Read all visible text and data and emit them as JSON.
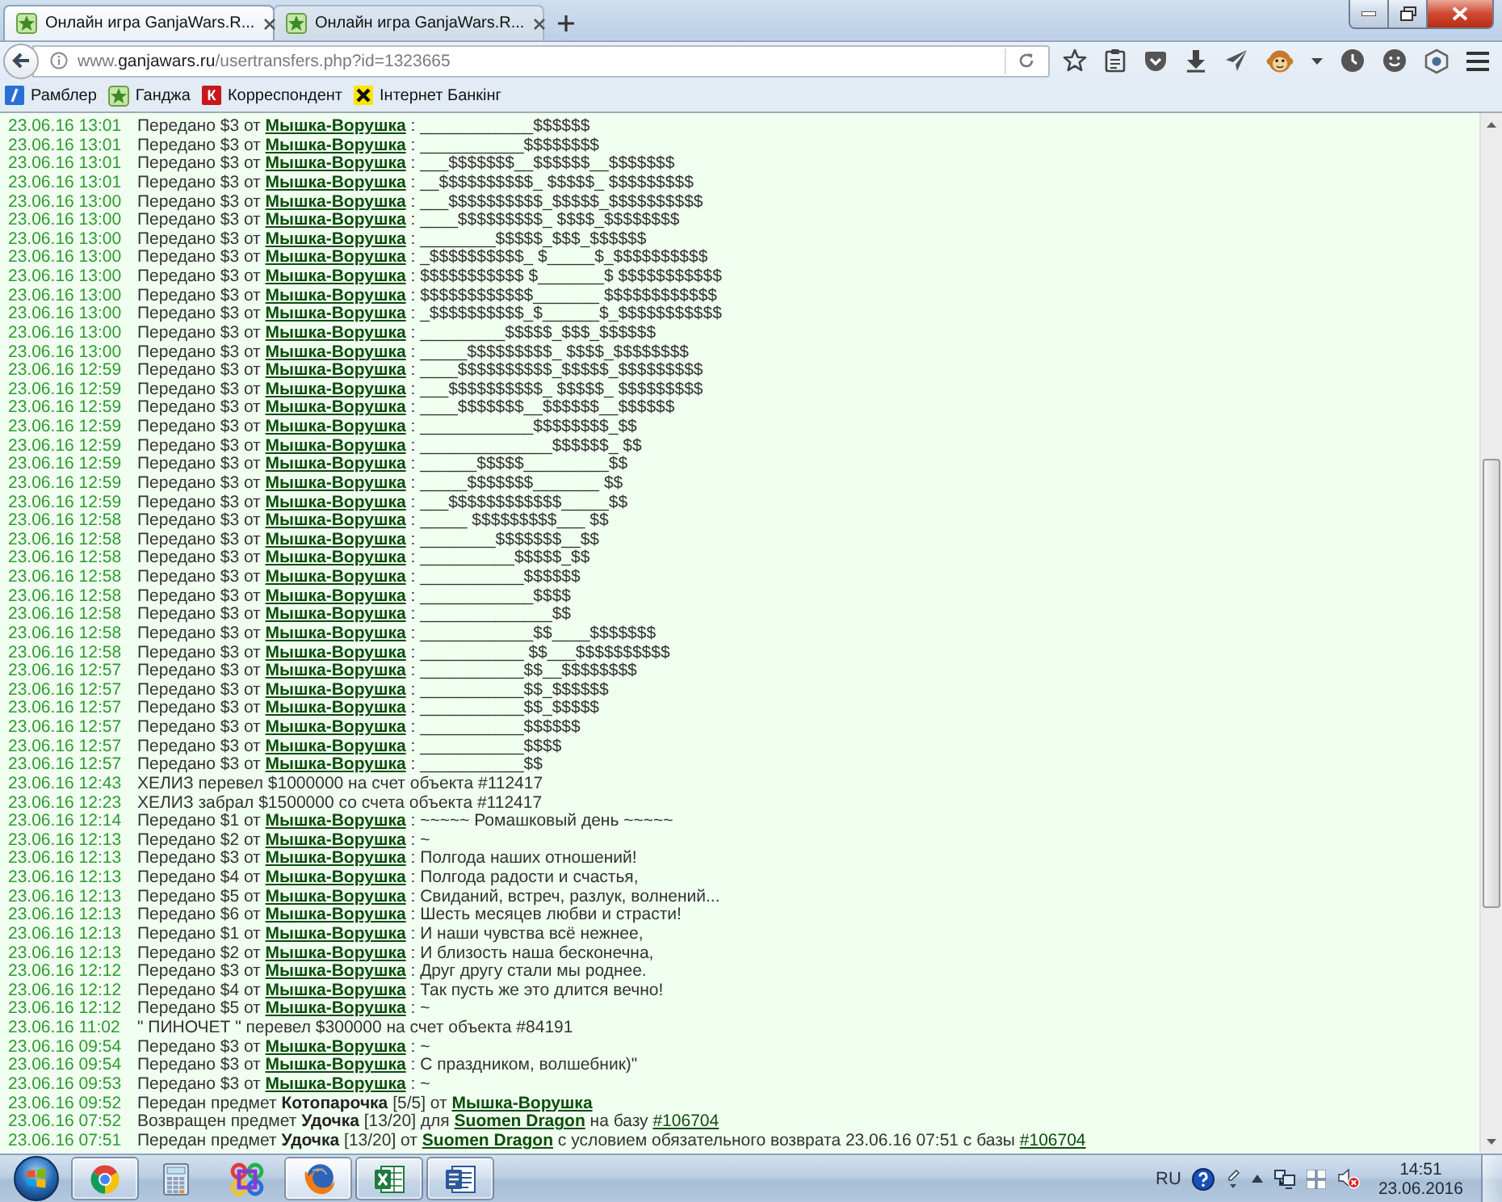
{
  "browser": {
    "tabs": [
      {
        "title": "Онлайн игра GanjaWars.R...",
        "selected": true
      },
      {
        "title": "Онлайн игра GanjaWars.R...",
        "selected": false
      }
    ],
    "address_bar": {
      "url_prefix": "www.",
      "url_domain": "ganjawars.ru",
      "url_path": "/usertransfers.php?id=1323665"
    },
    "bookmarks": [
      {
        "kind": "slash",
        "label": "Рамблер"
      },
      {
        "kind": "star",
        "label": "Ганджа"
      },
      {
        "kind": "letter",
        "icon_text": "К",
        "label": "Корреспондент"
      },
      {
        "kind": "cross",
        "label": "Інтернет Банкінг"
      }
    ]
  },
  "log": {
    "rows": [
      {
        "time": "23.06.16 13:01",
        "kind": "transfer",
        "action": "Передано $3 от",
        "user": "Мышка-Ворушка",
        "message": ": ____________$$$$$$"
      },
      {
        "time": "23.06.16 13:01",
        "kind": "transfer",
        "action": "Передано $3 от",
        "user": "Мышка-Ворушка",
        "message": ": ___________$$$$$$$$"
      },
      {
        "time": "23.06.16 13:01",
        "kind": "transfer",
        "action": "Передано $3 от",
        "user": "Мышка-Ворушка",
        "message": ": ___$$$$$$$__$$$$$$__$$$$$$$"
      },
      {
        "time": "23.06.16 13:01",
        "kind": "transfer",
        "action": "Передано $3 от",
        "user": "Мышка-Ворушка",
        "message": ": __$$$$$$$$$$_ $$$$$_ $$$$$$$$$"
      },
      {
        "time": "23.06.16 13:00",
        "kind": "transfer",
        "action": "Передано $3 от",
        "user": "Мышка-Ворушка",
        "message": ": ___$$$$$$$$$$_$$$$$_$$$$$$$$$$"
      },
      {
        "time": "23.06.16 13:00",
        "kind": "transfer",
        "action": "Передано $3 от",
        "user": "Мышка-Ворушка",
        "message": ": ____$$$$$$$$$_ $$$$_$$$$$$$$"
      },
      {
        "time": "23.06.16 13:00",
        "kind": "transfer",
        "action": "Передано $3 от",
        "user": "Мышка-Ворушка",
        "message": ": ________$$$$$_$$$_$$$$$$"
      },
      {
        "time": "23.06.16 13:00",
        "kind": "transfer",
        "action": "Передано $3 от",
        "user": "Мышка-Ворушка",
        "message": ": _$$$$$$$$$$_ $_____$_$$$$$$$$$$"
      },
      {
        "time": "23.06.16 13:00",
        "kind": "transfer",
        "action": "Передано $3 от",
        "user": "Мышка-Ворушка",
        "message": ": $$$$$$$$$$$ $_______$ $$$$$$$$$$$"
      },
      {
        "time": "23.06.16 13:00",
        "kind": "transfer",
        "action": "Передано $3 от",
        "user": "Мышка-Ворушка",
        "message": ": $$$$$$$$$$$$_______ $$$$$$$$$$$$"
      },
      {
        "time": "23.06.16 13:00",
        "kind": "transfer",
        "action": "Передано $3 от",
        "user": "Мышка-Ворушка",
        "message": ": _$$$$$$$$$$_$______$_$$$$$$$$$$$"
      },
      {
        "time": "23.06.16 13:00",
        "kind": "transfer",
        "action": "Передано $3 от",
        "user": "Мышка-Ворушка",
        "message": ": _________$$$$$_$$$_$$$$$$"
      },
      {
        "time": "23.06.16 13:00",
        "kind": "transfer",
        "action": "Передано $3 от",
        "user": "Мышка-Ворушка",
        "message": ": _____$$$$$$$$$_ $$$$_$$$$$$$$"
      },
      {
        "time": "23.06.16 12:59",
        "kind": "transfer",
        "action": "Передано $3 от",
        "user": "Мышка-Ворушка",
        "message": ": ____$$$$$$$$$$_$$$$$_$$$$$$$$$"
      },
      {
        "time": "23.06.16 12:59",
        "kind": "transfer",
        "action": "Передано $3 от",
        "user": "Мышка-Ворушка",
        "message": ": ___$$$$$$$$$$_ $$$$$_ $$$$$$$$$"
      },
      {
        "time": "23.06.16 12:59",
        "kind": "transfer",
        "action": "Передано $3 от",
        "user": "Мышка-Ворушка",
        "message": ": ____$$$$$$$__$$$$$$__$$$$$$"
      },
      {
        "time": "23.06.16 12:59",
        "kind": "transfer",
        "action": "Передано $3 от",
        "user": "Мышка-Ворушка",
        "message": ": ____________$$$$$$$$_$$"
      },
      {
        "time": "23.06.16 12:59",
        "kind": "transfer",
        "action": "Передано $3 от",
        "user": "Мышка-Ворушка",
        "message": ": ______________$$$$$$_ $$"
      },
      {
        "time": "23.06.16 12:59",
        "kind": "transfer",
        "action": "Передано $3 от",
        "user": "Мышка-Ворушка",
        "message": ": ______$$$$$_________$$"
      },
      {
        "time": "23.06.16 12:59",
        "kind": "transfer",
        "action": "Передано $3 от",
        "user": "Мышка-Ворушка",
        "message": ": _____$$$$$$$_______ $$"
      },
      {
        "time": "23.06.16 12:59",
        "kind": "transfer",
        "action": "Передано $3 от",
        "user": "Мышка-Ворушка",
        "message": ": ___$$$$$$$$$$$$_____$$"
      },
      {
        "time": "23.06.16 12:58",
        "kind": "transfer",
        "action": "Передано $3 от",
        "user": "Мышка-Ворушка",
        "message": ": _____ $$$$$$$$$___ $$"
      },
      {
        "time": "23.06.16 12:58",
        "kind": "transfer",
        "action": "Передано $3 от",
        "user": "Мышка-Ворушка",
        "message": ": ________$$$$$$$__$$"
      },
      {
        "time": "23.06.16 12:58",
        "kind": "transfer",
        "action": "Передано $3 от",
        "user": "Мышка-Ворушка",
        "message": ": __________$$$$$_$$"
      },
      {
        "time": "23.06.16 12:58",
        "kind": "transfer",
        "action": "Передано $3 от",
        "user": "Мышка-Ворушка",
        "message": ": ___________$$$$$$"
      },
      {
        "time": "23.06.16 12:58",
        "kind": "transfer",
        "action": "Передано $3 от",
        "user": "Мышка-Ворушка",
        "message": ": ____________$$$$"
      },
      {
        "time": "23.06.16 12:58",
        "kind": "transfer",
        "action": "Передано $3 от",
        "user": "Мышка-Ворушка",
        "message": ": ______________$$"
      },
      {
        "time": "23.06.16 12:58",
        "kind": "transfer",
        "action": "Передано $3 от",
        "user": "Мышка-Ворушка",
        "message": ": ____________$$____$$$$$$$"
      },
      {
        "time": "23.06.16 12:58",
        "kind": "transfer",
        "action": "Передано $3 от",
        "user": "Мышка-Ворушка",
        "message": ": ___________ $$___$$$$$$$$$$"
      },
      {
        "time": "23.06.16 12:57",
        "kind": "transfer",
        "action": "Передано $3 от",
        "user": "Мышка-Ворушка",
        "message": ": ___________$$__$$$$$$$$"
      },
      {
        "time": "23.06.16 12:57",
        "kind": "transfer",
        "action": "Передано $3 от",
        "user": "Мышка-Ворушка",
        "message": ": ___________$$_$$$$$$"
      },
      {
        "time": "23.06.16 12:57",
        "kind": "transfer",
        "action": "Передано $3 от",
        "user": "Мышка-Ворушка",
        "message": ": ___________$$_$$$$$"
      },
      {
        "time": "23.06.16 12:57",
        "kind": "transfer",
        "action": "Передано $3 от",
        "user": "Мышка-Ворушка",
        "message": ": ___________$$$$$$"
      },
      {
        "time": "23.06.16 12:57",
        "kind": "transfer",
        "action": "Передано $3 от",
        "user": "Мышка-Ворушка",
        "message": ": ___________$$$$"
      },
      {
        "time": "23.06.16 12:57",
        "kind": "transfer",
        "action": "Передано $3 от",
        "user": "Мышка-Ворушка",
        "message": ": ___________$$"
      },
      {
        "time": "23.06.16 12:43",
        "kind": "event",
        "parts": [
          {
            "kind": "text",
            "text": "ХЕЛИЗ перевел $1000000 на счет объекта #112417"
          }
        ]
      },
      {
        "time": "23.06.16 12:23",
        "kind": "event",
        "parts": [
          {
            "kind": "text",
            "text": "ХЕЛИЗ забрал $1500000 со счета объекта #112417"
          }
        ]
      },
      {
        "time": "23.06.16 12:14",
        "kind": "transfer",
        "action": "Передано $1 от",
        "user": "Мышка-Ворушка",
        "message": ": ~~~~~ Ромашковый день ~~~~~"
      },
      {
        "time": "23.06.16 12:13",
        "kind": "transfer",
        "action": "Передано $2 от",
        "user": "Мышка-Ворушка",
        "message": ": ~"
      },
      {
        "time": "23.06.16 12:13",
        "kind": "transfer",
        "action": "Передано $3 от",
        "user": "Мышка-Ворушка",
        "message": ": Полгода наших отношений!"
      },
      {
        "time": "23.06.16 12:13",
        "kind": "transfer",
        "action": "Передано $4 от",
        "user": "Мышка-Ворушка",
        "message": ": Полгода радости и счастья,"
      },
      {
        "time": "23.06.16 12:13",
        "kind": "transfer",
        "action": "Передано $5 от",
        "user": "Мышка-Ворушка",
        "message": ": Свиданий, встреч, разлук, волнений..."
      },
      {
        "time": "23.06.16 12:13",
        "kind": "transfer",
        "action": "Передано $6 от",
        "user": "Мышка-Ворушка",
        "message": ": Шесть месяцев любви и страсти!"
      },
      {
        "time": "23.06.16 12:13",
        "kind": "transfer",
        "action": "Передано $1 от",
        "user": "Мышка-Ворушка",
        "message": ": И наши чувства всё нежнее,"
      },
      {
        "time": "23.06.16 12:13",
        "kind": "transfer",
        "action": "Передано $2 от",
        "user": "Мышка-Ворушка",
        "message": ": И близость наша бесконечна,"
      },
      {
        "time": "23.06.16 12:12",
        "kind": "transfer",
        "action": "Передано $3 от",
        "user": "Мышка-Ворушка",
        "message": ": Друг другу стали мы роднее."
      },
      {
        "time": "23.06.16 12:12",
        "kind": "transfer",
        "action": "Передано $4 от",
        "user": "Мышка-Ворушка",
        "message": ": Так пусть же это длится вечно!"
      },
      {
        "time": "23.06.16 12:12",
        "kind": "transfer",
        "action": "Передано $5 от",
        "user": "Мышка-Ворушка",
        "message": ": ~"
      },
      {
        "time": "23.06.16 11:02",
        "kind": "event",
        "parts": [
          {
            "kind": "text",
            "text": "\" ПИНОЧЕТ \" перевел $300000 на счет объекта #84191"
          }
        ]
      },
      {
        "time": "23.06.16 09:54",
        "kind": "transfer",
        "action": "Передано $3 от",
        "user": "Мышка-Ворушка",
        "message": ": ~"
      },
      {
        "time": "23.06.16 09:54",
        "kind": "transfer",
        "action": "Передано $3 от",
        "user": "Мышка-Ворушка",
        "message": ": С праздником, волшебник)\""
      },
      {
        "time": "23.06.16 09:53",
        "kind": "transfer",
        "action": "Передано $3 от",
        "user": "Мышка-Ворушка",
        "message": ": ~"
      },
      {
        "time": "23.06.16 09:52",
        "kind": "event",
        "parts": [
          {
            "kind": "text",
            "text": "Передан предмет"
          },
          {
            "kind": "bold",
            "text": "Котопарочка"
          },
          {
            "kind": "text",
            "text": "[5/5] от"
          },
          {
            "kind": "user_link",
            "text": "Мышка-Ворушка"
          }
        ]
      },
      {
        "time": "23.06.16 07:52",
        "kind": "event",
        "parts": [
          {
            "kind": "text",
            "text": "Возвращен предмет"
          },
          {
            "kind": "bold",
            "text": "Удочка"
          },
          {
            "kind": "text",
            "text": "[13/20] для"
          },
          {
            "kind": "user_link",
            "text": "Suomen Dragon"
          },
          {
            "kind": "text",
            "text": "на базу"
          },
          {
            "kind": "link",
            "text": "#106704"
          }
        ]
      },
      {
        "time": "23.06.16 07:51",
        "kind": "event",
        "parts": [
          {
            "kind": "text",
            "text": "Передан предмет"
          },
          {
            "kind": "bold",
            "text": "Удочка"
          },
          {
            "kind": "text",
            "text": "[13/20] от"
          },
          {
            "kind": "user_link",
            "text": "Suomen Dragon"
          },
          {
            "kind": "text",
            "text": "с условием обязательного возврата 23.06.16 07:51 с базы"
          },
          {
            "kind": "link",
            "text": "#106704"
          }
        ]
      }
    ]
  },
  "taskbar": {
    "apps": [
      {
        "kind": "chrome",
        "running": true,
        "selected": false
      },
      {
        "kind": "calculator",
        "running": false,
        "selected": false
      },
      {
        "kind": "knot",
        "running": false,
        "selected": false
      },
      {
        "kind": "firefox",
        "running": true,
        "selected": true
      },
      {
        "kind": "spreadsheet",
        "running": true,
        "selected": false
      },
      {
        "kind": "document",
        "running": true,
        "selected": false
      }
    ],
    "language": "RU",
    "time": "14:51",
    "date": "23.06.2016"
  }
}
